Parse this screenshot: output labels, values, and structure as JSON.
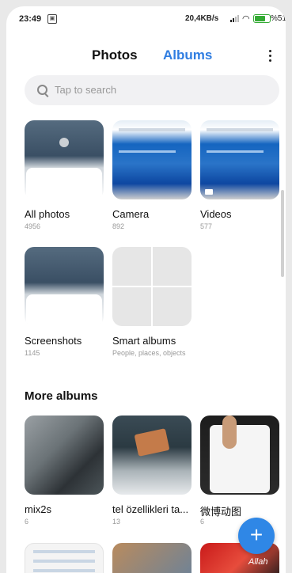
{
  "status": {
    "time": "23:49",
    "speed": "20,4KB/s",
    "battery_pct": "%51"
  },
  "tabs": {
    "photos": "Photos",
    "albums": "Albums"
  },
  "search": {
    "placeholder": "Tap to search"
  },
  "albums": [
    {
      "title": "All photos",
      "count": "4956"
    },
    {
      "title": "Camera",
      "count": "892"
    },
    {
      "title": "Videos",
      "count": "577"
    },
    {
      "title": "Screenshots",
      "count": "1145"
    },
    {
      "title": "Smart albums",
      "count": "People, places, objects"
    }
  ],
  "more_albums": {
    "title": "More albums",
    "items": [
      {
        "title": "mix2s",
        "count": "6"
      },
      {
        "title": "tel özellikleri ta...",
        "count": "13"
      },
      {
        "title": "微博动图",
        "count": "6"
      }
    ]
  },
  "fab": {
    "label": "+"
  },
  "watermark": "Allah"
}
